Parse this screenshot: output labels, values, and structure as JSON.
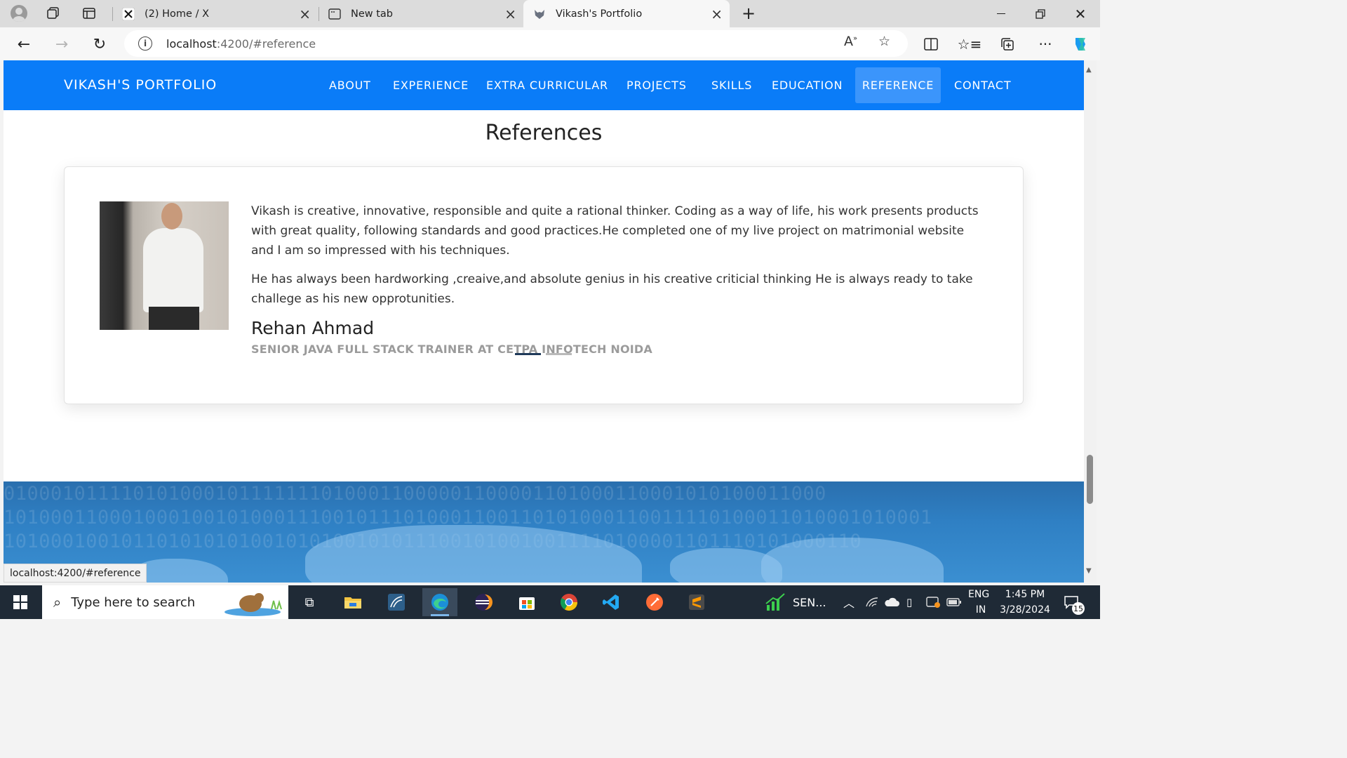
{
  "browser": {
    "tabs": [
      {
        "title": "(2) Home / X",
        "icon": "x-logo-icon"
      },
      {
        "title": "New tab",
        "icon": "new-tab-icon"
      },
      {
        "title": "Vikash's Portfolio",
        "icon": "wolf-favicon-icon"
      }
    ],
    "url_host": "localhost",
    "url_rest": ":4200/#reference"
  },
  "site": {
    "brand": "VIKASH'S PORTFOLIO",
    "menu": [
      "ABOUT",
      "EXPERIENCE",
      "EXTRA CURRICULAR",
      "PROJECTS",
      "SKILLS",
      "EDUCATION",
      "REFERENCE",
      "CONTACT"
    ],
    "active_menu": "REFERENCE",
    "section_title": "References",
    "reference": {
      "paragraph1": "Vikash is creative, innovative, responsible and quite a rational thinker. Coding as a way of life, his work presents products with great quality, following standards and good practices.He completed one of my live project on matrimonial website and I am so impressed with his techniques.",
      "paragraph2": "He has always been hardworking ,creaive,and absolute genius in his creative criticial thinking He is always ready to take challege as his new opprotunities.",
      "name": "Rehan Ahmad",
      "role": "SENIOR JAVA FULL STACK TRAINER AT CETPA INFOTECH NOIDA"
    },
    "binary_rows": [
      "0100010111101010001011111110100011000001100001101000110001010100011000",
      "1010001100010001001010001110010111010001100110101000110011110100011010001010001",
      "1010001001011010101010010101001010111001010010011110100001101110101000110"
    ]
  },
  "status_url": "localhost:4200/#reference",
  "taskbar": {
    "search_placeholder": "Type here to search",
    "tray_app_label": "SEN...",
    "lang_top": "ENG",
    "lang_bottom": "IN",
    "time": "1:45 PM",
    "date": "3/28/2024",
    "notification_count": "15"
  },
  "colors": {
    "nav_bg": "#0a7cf8",
    "nav_active": "#3b95fb",
    "footer": "#2f80c4"
  }
}
